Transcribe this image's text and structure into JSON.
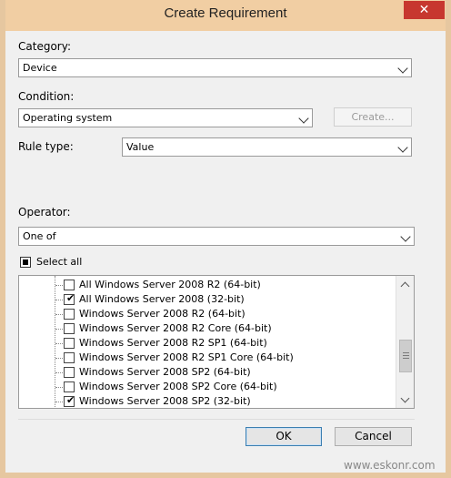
{
  "window": {
    "title": "Create Requirement",
    "close_glyph": "✕"
  },
  "category": {
    "label": "Category:",
    "value": "Device"
  },
  "condition": {
    "label": "Condition:",
    "value": "Operating system",
    "create_button": "Create..."
  },
  "rule_type": {
    "label": "Rule type:",
    "value": "Value"
  },
  "operator": {
    "label": "Operator:",
    "value": "One of"
  },
  "select_all": {
    "label": "Select all",
    "state": "indeterminate"
  },
  "os_list": {
    "items": [
      {
        "label": "All Windows Server 2008 R2 (64-bit)",
        "checked": false
      },
      {
        "label": "All Windows Server 2008 (32-bit)",
        "checked": true
      },
      {
        "label": "Windows Server 2008 R2 (64-bit)",
        "checked": false
      },
      {
        "label": "Windows Server 2008 R2 Core (64-bit)",
        "checked": false
      },
      {
        "label": "Windows Server 2008 R2 SP1 (64-bit)",
        "checked": false
      },
      {
        "label": "Windows Server 2008 R2 SP1 Core (64-bit)",
        "checked": false
      },
      {
        "label": "Windows Server 2008 SP2 (64-bit)",
        "checked": false
      },
      {
        "label": "Windows Server 2008 SP2 Core (64-bit)",
        "checked": false
      },
      {
        "label": "Windows Server 2008 SP2 (32-bit)",
        "checked": true
      }
    ],
    "check_glyph": "✔"
  },
  "buttons": {
    "ok": "OK",
    "cancel": "Cancel"
  },
  "watermark": "www.eskonr.com",
  "colors": {
    "titlebar": "#f1cea3",
    "close": "#c7372f",
    "dialog_bg": "#f0f0f0",
    "focus_border": "#3c7fb1"
  }
}
